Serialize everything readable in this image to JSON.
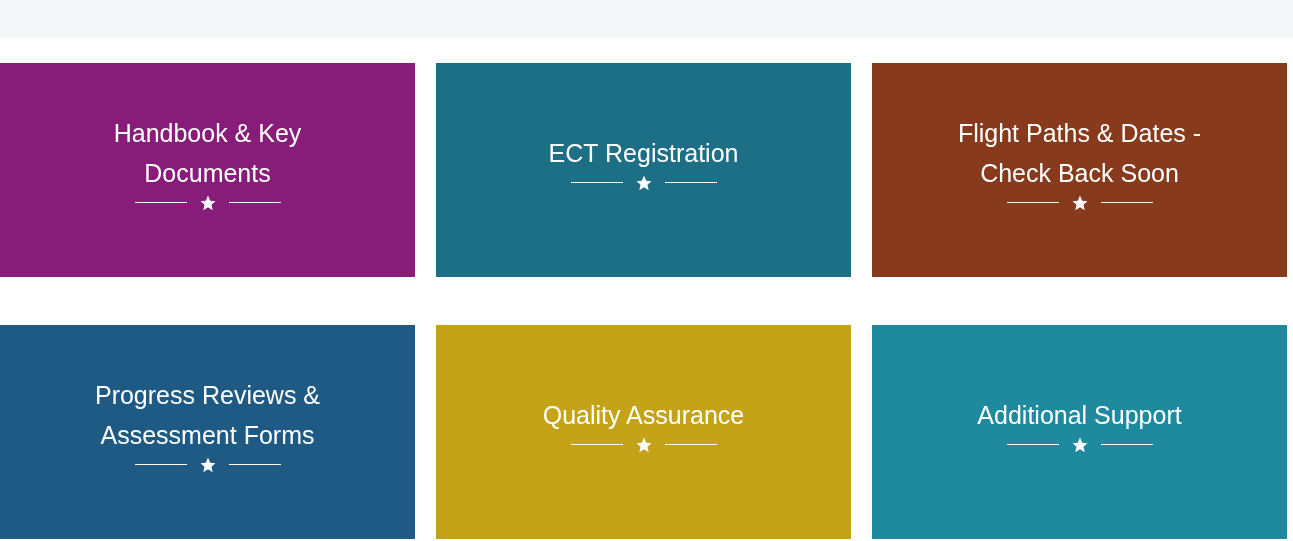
{
  "cards": [
    {
      "title": "Handbook & Key Documents",
      "color": "#871c79"
    },
    {
      "title": "ECT Registration",
      "color": "#1d6f86"
    },
    {
      "title": "Flight Paths & Dates - Check Back Soon",
      "color": "#873a1c"
    },
    {
      "title": "Progress Reviews & Assessment Forms",
      "color": "#1f5a85"
    },
    {
      "title": "Quality Assurance",
      "color": "#c4a318"
    },
    {
      "title": "Additional Support",
      "color": "#1f899d"
    }
  ]
}
